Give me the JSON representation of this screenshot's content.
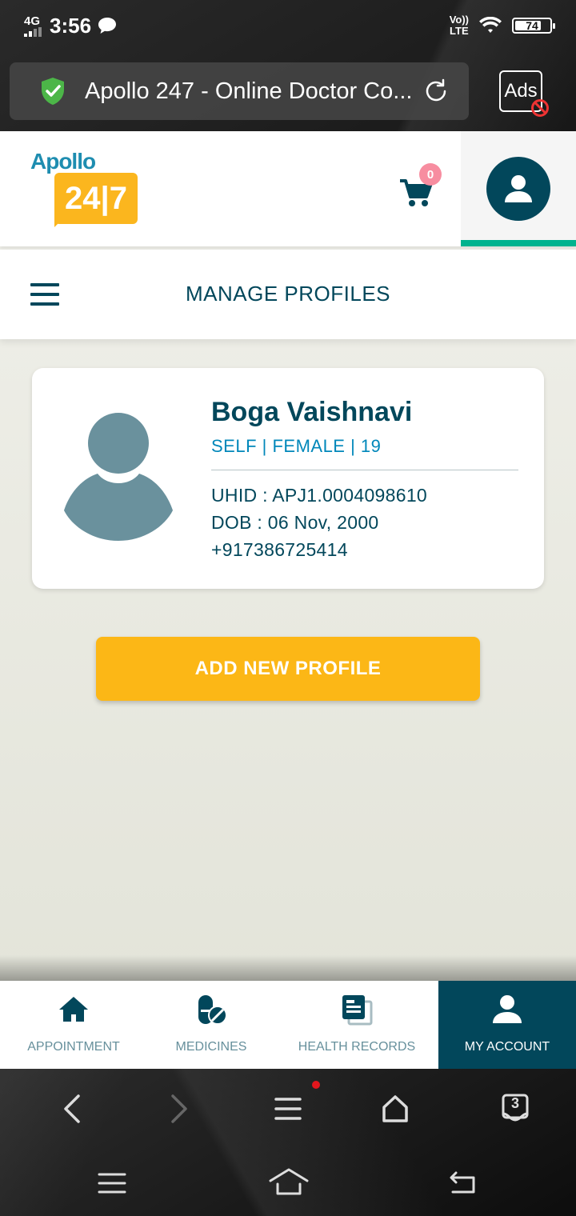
{
  "status_bar": {
    "network": "4G",
    "time": "3:56",
    "lte": "Vo))\nLTE",
    "battery": "74"
  },
  "browser": {
    "url_title": "Apollo 247 - Online Doctor Co...",
    "ads_label": "Ads",
    "tab_count": "3"
  },
  "header": {
    "logo_top": "Apollo",
    "logo_bottom": "24|7",
    "cart_count": "0"
  },
  "subheader": {
    "title": "MANAGE PROFILES"
  },
  "profile": {
    "name": "Boga Vaishnavi",
    "meta": "SELF | FEMALE | 19",
    "uhid": "UHID : APJ1.0004098610",
    "dob": "DOB : 06 Nov, 2000",
    "phone": "+917386725414"
  },
  "actions": {
    "add_profile": "ADD NEW PROFILE"
  },
  "bottom_nav": {
    "items": [
      {
        "label": "APPOINTMENT",
        "icon": "home-icon"
      },
      {
        "label": "MEDICINES",
        "icon": "pill-icon"
      },
      {
        "label": "HEALTH RECORDS",
        "icon": "records-icon"
      },
      {
        "label": "MY ACCOUNT",
        "icon": "user-icon",
        "active": true
      }
    ]
  },
  "colors": {
    "primary": "#02475b",
    "accent": "#fcb716",
    "teal": "#00b38e",
    "link_blue": "#0087ba"
  }
}
